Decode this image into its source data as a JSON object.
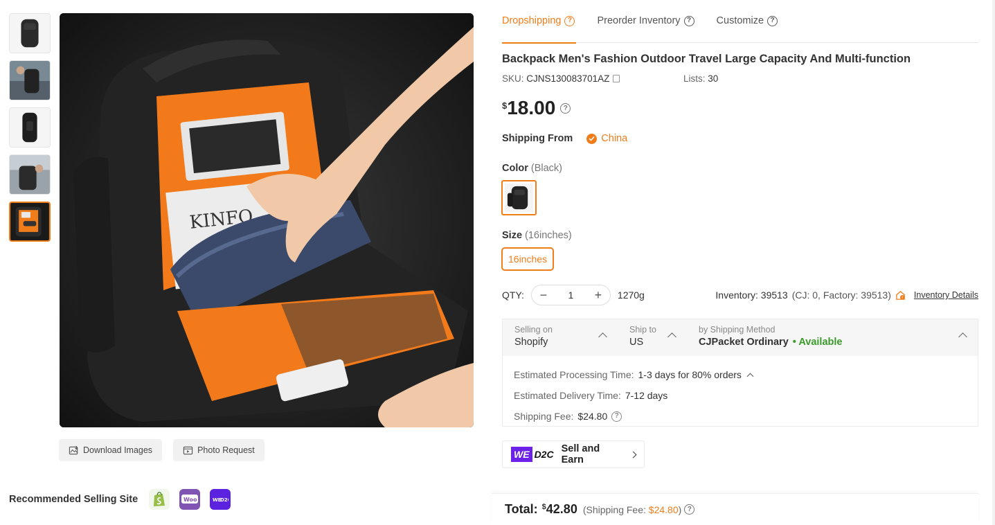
{
  "thumbnails": [
    {
      "name": "thumb-1",
      "active": false
    },
    {
      "name": "thumb-2",
      "active": false
    },
    {
      "name": "thumb-3",
      "active": false
    },
    {
      "name": "thumb-4",
      "active": false
    },
    {
      "name": "thumb-5",
      "active": true
    }
  ],
  "image_actions": {
    "download": "Download Images",
    "photo_request": "Photo Request"
  },
  "recommended": {
    "label": "Recommended Selling Site",
    "sites": [
      "shopify-icon",
      "woocommerce-icon",
      "wed2c-icon"
    ]
  },
  "tabs": [
    {
      "label": "Dropshipping",
      "active": true
    },
    {
      "label": "Preorder Inventory",
      "active": false
    },
    {
      "label": "Customize",
      "active": false
    }
  ],
  "product": {
    "title": "Backpack Men's Fashion Outdoor Travel Large Capacity And Multi-function",
    "sku_label": "SKU:",
    "sku": "CJNS130083701AZ",
    "lists_label": "Lists:",
    "lists": "30",
    "currency": "$",
    "price": "18.00"
  },
  "shipping_from": {
    "label": "Shipping From",
    "value": "China"
  },
  "color": {
    "label": "Color",
    "selected": "(Black)"
  },
  "size": {
    "label": "Size",
    "selected": "(16inches)",
    "option": "16inches"
  },
  "quantity": {
    "label": "QTY:",
    "value": "1",
    "weight": "1270g",
    "inventory": "Inventory: 39513",
    "inventory_detail": "(CJ: 0, Factory: 39513)",
    "inventory_link": "Inventory Details"
  },
  "shipping": {
    "selling_on_label": "Selling on",
    "selling_on": "Shopify",
    "ship_to_label": "Ship to",
    "ship_to": "US",
    "method_label": "by Shipping Method",
    "method": "CJPacket Ordinary",
    "status": "• Available",
    "processing_label": "Estimated Processing Time:",
    "processing": "1-3 days for 80% orders",
    "delivery_label": "Estimated Delivery Time:",
    "delivery": "7-12 days",
    "fee_label": "Shipping Fee:",
    "fee": "$24.80"
  },
  "wed2c": {
    "we": "WE",
    "d2c": "D2C",
    "text": "Sell and Earn"
  },
  "total": {
    "label": "Total:",
    "currency": "$",
    "amount": "42.80",
    "fee_prefix": "(Shipping Fee:",
    "fee": "$24.80",
    "fee_suffix": ")"
  },
  "colors": {
    "accent": "#f07c1a",
    "available": "#3a9b2b",
    "wed2c_purple": "#6b21e8"
  }
}
